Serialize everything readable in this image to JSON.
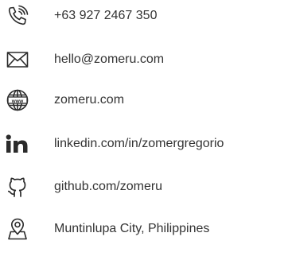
{
  "contact": {
    "items": [
      {
        "icon": "phone-icon",
        "label": "+63 927 2467 350"
      },
      {
        "icon": "mail-icon",
        "label": "hello@zomeru.com"
      },
      {
        "icon": "globe-icon",
        "label": "zomeru.com"
      },
      {
        "icon": "linkedin-icon",
        "label": "linkedin.com/in/zomergregorio"
      },
      {
        "icon": "github-icon",
        "label": "github.com/zomeru"
      },
      {
        "icon": "location-pin-icon",
        "label": "Muntinlupa City, Philippines"
      }
    ]
  },
  "colors": {
    "text": "#333333",
    "icon": "#2b2b2b"
  }
}
